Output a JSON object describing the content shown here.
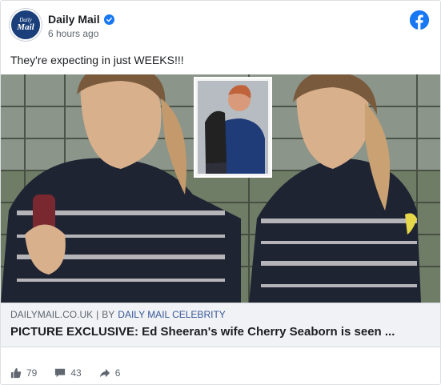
{
  "header": {
    "page_name": "Daily Mail",
    "time": "6 hours ago",
    "avatar_line1": "Daily",
    "avatar_line2": "Mail"
  },
  "post": {
    "text": "They're expecting in just WEEKS!!!"
  },
  "link": {
    "domain": "DAILYMAIL.CO.UK",
    "separator": "|",
    "by_prefix": "BY",
    "author": "DAILY MAIL CELEBRITY",
    "title": "PICTURE EXCLUSIVE: Ed Sheeran's wife Cherry Seaborn is seen ..."
  },
  "stats": {
    "likes": "79",
    "comments": "43",
    "shares": "6"
  },
  "icons": {
    "verified": "verified-badge-icon",
    "facebook": "facebook-logo-icon",
    "like": "thumbs-up-icon",
    "comment": "comment-bubble-icon",
    "share": "share-arrow-icon"
  },
  "colors": {
    "brand_blue": "#1877f2",
    "avatar_navy": "#1a3f7a",
    "link_author": "#385898"
  }
}
